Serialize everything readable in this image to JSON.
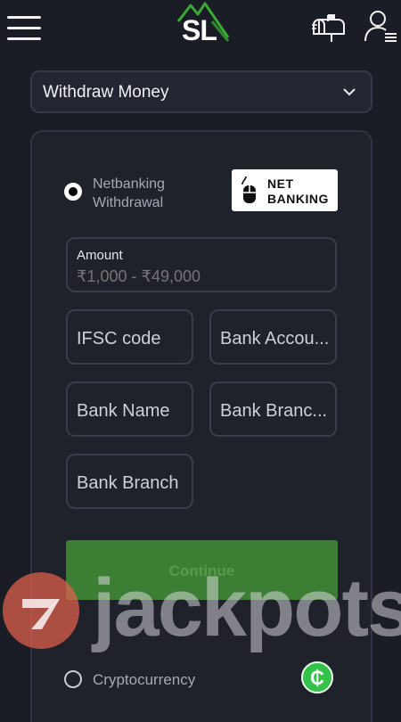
{
  "header": {
    "logo_text": "SL",
    "icons": [
      "menu-icon",
      "mailbox-icon",
      "user-menu-icon"
    ]
  },
  "withdraw_select": {
    "selected": "Withdraw Money"
  },
  "methods": {
    "netbanking": {
      "label_line1": "Netbanking",
      "label_line2": "Withdrawal",
      "badge_line1": "NET",
      "badge_line2": "BANKING",
      "checked": true
    },
    "crypto": {
      "label": "Cryptocurrency",
      "icon_glyph": "₵",
      "checked": false
    }
  },
  "form": {
    "amount_label": "Amount",
    "amount_placeholder": "₹1,000 - ₹49,000",
    "ifsc_placeholder": "IFSC code",
    "bank_account_placeholder": "Bank Accou...",
    "bank_name_placeholder": "Bank Name",
    "bank_branch_placeholder_2": "Bank Branc...",
    "bank_branch_placeholder": "Bank Branch",
    "continue_label": "Continue"
  },
  "watermark": {
    "text": "jackpots"
  },
  "colors": {
    "background": "#1b1d26",
    "continue_button": "#3c7e33",
    "crypto_badge": "#34c24a",
    "watermark_circle": "#e4604c"
  }
}
